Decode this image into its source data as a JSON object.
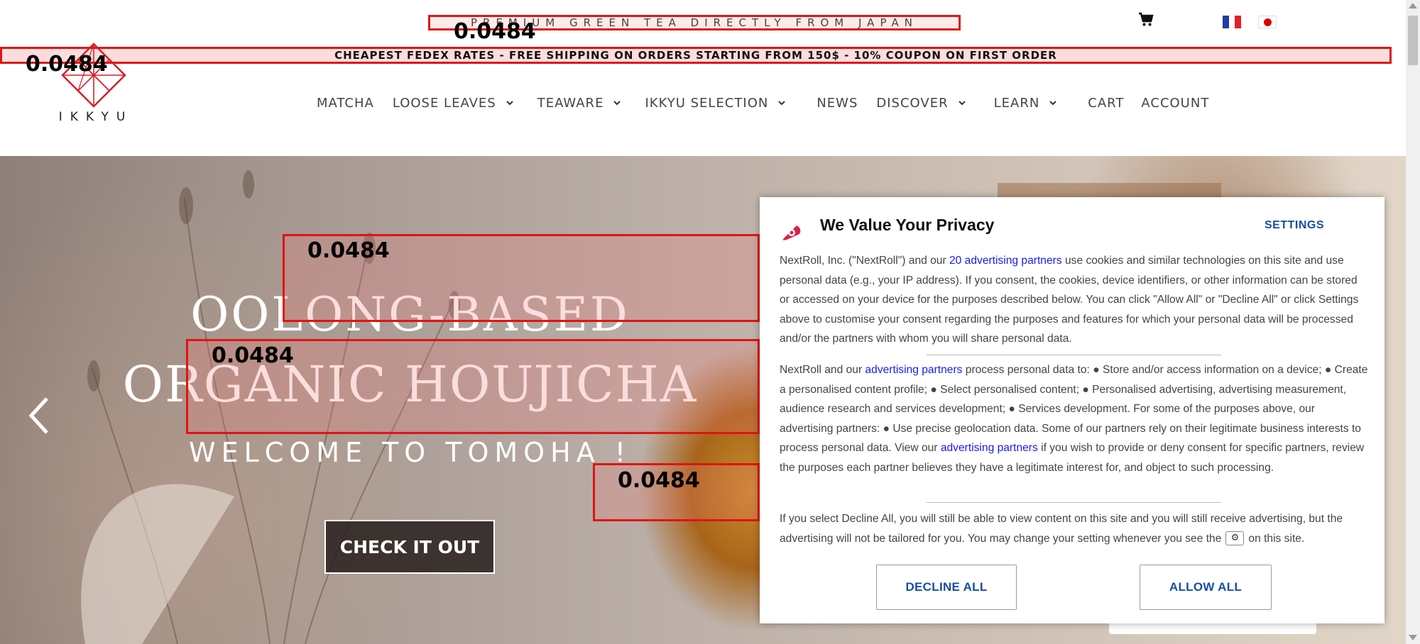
{
  "topbar": {
    "tagline": "PREMIUM GREEN TEA DIRECTLY FROM JAPAN",
    "cart_icon": "shopping-cart-icon"
  },
  "shipping_banner": {
    "text": "CHEAPEST FEDEX RATES - FREE SHIPPING ON ORDERS STARTING FROM 150$ - 10% COUPON ON FIRST ORDER"
  },
  "languages": [
    {
      "name": "flag-france-icon"
    },
    {
      "name": "flag-japan-icon"
    }
  ],
  "logo": {
    "word": "IKKYU"
  },
  "nav": {
    "items": [
      {
        "label": "MATCHA",
        "has_dropdown": false
      },
      {
        "label": "LOOSE LEAVES",
        "has_dropdown": true
      },
      {
        "label": "TEAWARE",
        "has_dropdown": true
      },
      {
        "label": "IKKYU SELECTION",
        "has_dropdown": true
      },
      {
        "label": "NEWS",
        "has_dropdown": false
      },
      {
        "label": "DISCOVER",
        "has_dropdown": true
      },
      {
        "label": "LEARN",
        "has_dropdown": true
      },
      {
        "label": "CART",
        "has_dropdown": false
      },
      {
        "label": "ACCOUNT",
        "has_dropdown": false
      }
    ]
  },
  "hero": {
    "title_line1": "OOLONG-BASED",
    "title_line2": "ORGANIC HOUJICHA",
    "subtitle": "WELCOME TO TOMOHA !",
    "cta": "CHECK IT OUT",
    "prev_icon": "chevron-left-icon"
  },
  "overlay_scores": {
    "premium": "0.0484",
    "shipping": "0.0484",
    "title1": "0.0484",
    "title2": "0.0484",
    "subtitle": "0.0484"
  },
  "privacy": {
    "title": "We Value Your Privacy",
    "settings": "SETTINGS",
    "p1_a": "NextRoll, Inc. (\"NextRoll\") and our ",
    "p1_link": "20 advertising partners",
    "p1_b": " use cookies and similar technologies on this site and use personal data (e.g., your IP address). If you consent, the cookies, device identifiers, or other information can be stored or accessed on your device for the purposes described below. You can click \"Allow All\" or \"Decline All\" or click Settings above to customise your consent regarding the purposes and features for which your personal data will be processed and/or the partners with whom you will share personal data.",
    "p2_a": "NextRoll and our ",
    "p2_link1": "advertising partners",
    "p2_b": " process personal data to: ● Store and/or access information on a device; ● Create a personalised content profile; ● Select personalised content; ● Personalised advertising, advertising measurement, audience research and services development; ● Services development. For some of the purposes above, our advertising partners: ● Use precise geolocation data. Some of our partners rely on their legitimate business interests to process personal data. View our ",
    "p2_link2": "advertising partners",
    "p2_c": " if you wish to provide or deny consent for specific partners, review the purposes each partner believes they have a legitimate interest for, and object to such processing.",
    "p3_a": "If you select Decline All, you will still be able to view content on this site and you will still receive advertising, but the advertising will not be tailored for you. You may change your setting whenever you see the",
    "p3_b": "on this site.",
    "decline": "DECLINE ALL",
    "allow": "ALLOW ALL"
  },
  "colors": {
    "accent_red": "#e01414",
    "modal_link": "#1a4ea3",
    "hero_text": "#ffffff"
  }
}
